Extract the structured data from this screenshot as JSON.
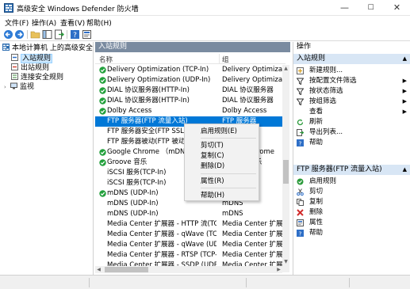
{
  "window": {
    "title": "高级安全 Windows Defender 防火墙",
    "minimize": "—",
    "maximize": "☐",
    "close": "✕"
  },
  "menu": [
    "文件(F)",
    "操作(A)",
    "查看(V)",
    "帮助(H)"
  ],
  "tree": {
    "root": "本地计算机 上的高级安全 Win",
    "items": [
      "入站规则",
      "出站规则",
      "连接安全规则",
      "监视"
    ]
  },
  "middle": {
    "header": "入站规则",
    "col_name": "名称",
    "col_group": "组",
    "rows": [
      {
        "name": "Delivery Optimization (TCP-In)",
        "group": "Delivery Optimization",
        "enabled": true
      },
      {
        "name": "Delivery Optimization (UDP-In)",
        "group": "Delivery Optimization",
        "enabled": true
      },
      {
        "name": "DIAL 协议服务器(HTTP-In)",
        "group": "DIAL 协议服务器",
        "enabled": true
      },
      {
        "name": "DIAL 协议服务器(HTTP-In)",
        "group": "DIAL 协议服务器",
        "enabled": true
      },
      {
        "name": "Dolby Access",
        "group": "Dolby Access",
        "enabled": true
      },
      {
        "name": "FTP 服务器(FTP 流量入站)",
        "group": "FTP 服务器",
        "enabled": false,
        "selected": true
      },
      {
        "name": "FTP 服务器安全(FTP SSL 流",
        "group": "FTP 服务器",
        "enabled": false
      },
      {
        "name": "FTP 服务器被动(FTP 被动流",
        "group": "FTP 服务器",
        "enabled": false
      },
      {
        "name": "Google Chrome （mDNS 入",
        "group": "Google Chrome",
        "enabled": true
      },
      {
        "name": "Groove 音乐",
        "group": "Groove 音乐",
        "enabled": true
      },
      {
        "name": "iSCSI 服务(TCP-In)",
        "group": "iSCSI 服务",
        "enabled": false
      },
      {
        "name": "iSCSI 服务(TCP-In)",
        "group": "iSCSI 服务",
        "enabled": false
      },
      {
        "name": "mDNS (UDP-In)",
        "group": "mDNS",
        "enabled": true
      },
      {
        "name": "mDNS (UDP-In)",
        "group": "mDNS",
        "enabled": false
      },
      {
        "name": "mDNS (UDP-In)",
        "group": "mDNS",
        "enabled": false
      },
      {
        "name": "Media Center 扩展器 - HTTP 流(TCP-In)",
        "group": "Media Center 扩展器",
        "enabled": false
      },
      {
        "name": "Media Center 扩展器 - qWave (TCP-In)",
        "group": "Media Center 扩展器",
        "enabled": false
      },
      {
        "name": "Media Center 扩展器 - qWave (UDP-In)",
        "group": "Media Center 扩展器",
        "enabled": false
      },
      {
        "name": "Media Center 扩展器 - RTSP (TCP-In)",
        "group": "Media Center 扩展器",
        "enabled": false
      },
      {
        "name": "Media Center 扩展器 - SSDP (UDP-In)",
        "group": "Media Center 扩展器",
        "enabled": false
      }
    ]
  },
  "context_menu": {
    "items": [
      "启用规则(E)",
      "剪切(T)",
      "复制(C)",
      "删除(D)",
      "属性(R)",
      "帮助(H)"
    ]
  },
  "actions": {
    "title": "操作",
    "section1": "入站规则",
    "section1_items": [
      "新建规则...",
      "按配置文件筛选",
      "按状态筛选",
      "按组筛选",
      "查看",
      "刷新",
      "导出列表...",
      "帮助"
    ],
    "section2": "FTP 服务器(FTP 流量入站)",
    "section2_items": [
      "启用规则",
      "剪切",
      "复制",
      "删除",
      "属性",
      "帮助"
    ]
  },
  "colors": {
    "enabled_check": "#22a03c",
    "selection": "#0078d7",
    "panel_header": "#7a8ba0",
    "action_header": "#d8e6f5"
  }
}
